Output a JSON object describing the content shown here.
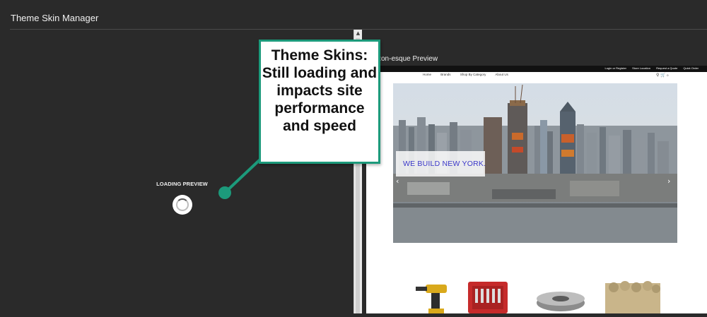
{
  "app": {
    "title": "Theme Skin Manager"
  },
  "left_panel": {
    "loading_label": "LOADING PREVIEW"
  },
  "preview": {
    "title": "zon-esque Preview",
    "site": {
      "topbar_links": [
        "Login or Register",
        "Store Location",
        "Request a Quote",
        "Quick Order"
      ],
      "nav_items": [
        "Home",
        "Brands",
        "Shop By Category",
        "About Us"
      ],
      "cart_count": "0",
      "hero_text": "WE BUILD NEW YORK."
    }
  },
  "annotation": {
    "callout_text": "Theme Skins: Still loading and impacts site performance and speed",
    "color": "#1c9a7b"
  },
  "icons": [
    "loading-spinner-icon",
    "scroll-up-arrow-icon",
    "search-icon",
    "cart-icon",
    "chevron-left-icon",
    "chevron-right-icon"
  ]
}
